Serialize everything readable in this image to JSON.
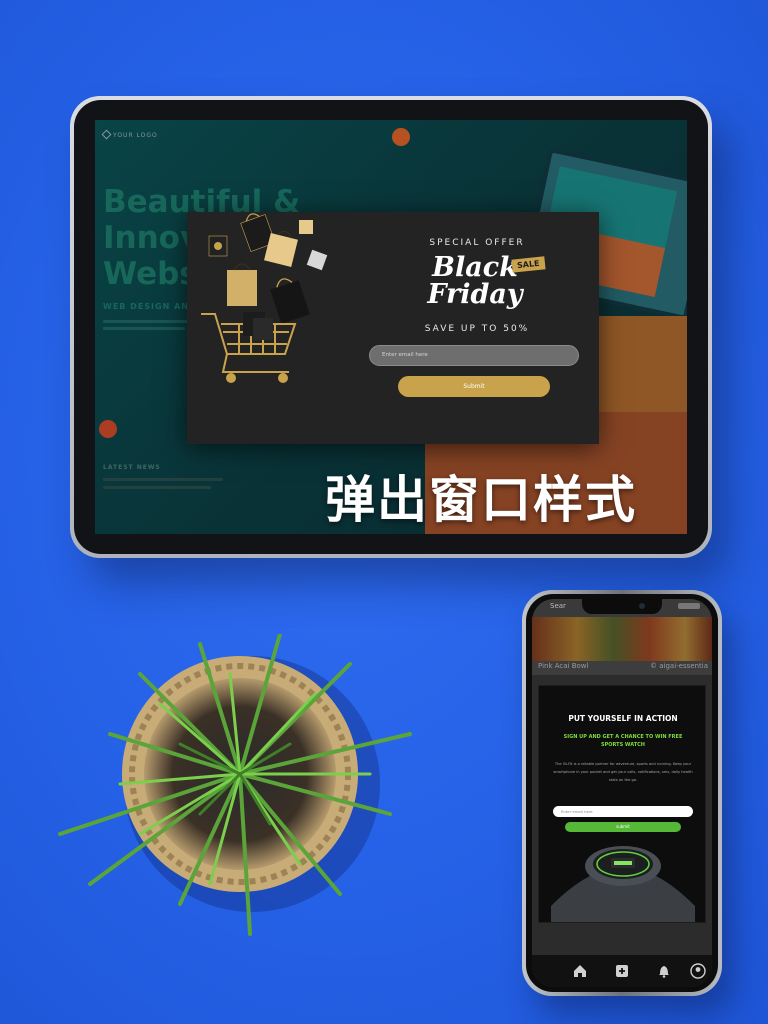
{
  "caption": "弹出窗口样式",
  "colors": {
    "background": "#2561e6",
    "gold": "#c9a34c",
    "green": "#55b937"
  },
  "tablet": {
    "site": {
      "logo": "YOUR LOGO",
      "hero_lines": [
        "Beautiful &",
        "Innov",
        "Webs"
      ],
      "subtitle": "WEB DESIGN AN",
      "news": "LATEST NEWS"
    },
    "popup": {
      "offer": "SPECIAL OFFER",
      "title_line1": "Black",
      "title_line2": "Friday",
      "badge": "SALE",
      "save": "SAVE UP TO 50%",
      "email_placeholder": "Enter email here",
      "submit": "Submit"
    }
  },
  "phone": {
    "status_left": "Sear",
    "food_label_left": "Pink Acai Bowl",
    "food_label_right": "© aigai-essentia",
    "popup": {
      "title": "PUT YOURSELF IN ACTION",
      "sub_line1": "SIGN UP AND GET A CHANCE TO WIN FREE",
      "sub_line2": "SPORTS WATCH",
      "body_lines": [
        "The Gt-Fit is a reliable partner for adventure, sports and running. Keep your",
        "smartphone in your pocket and get your calls, notifications, sms, daily health",
        "stats on the go."
      ],
      "email_placeholder": "Enter email here",
      "submit": "submit"
    },
    "nav_icons": [
      "home-icon",
      "add-icon",
      "bell-icon",
      "profile-icon"
    ]
  }
}
